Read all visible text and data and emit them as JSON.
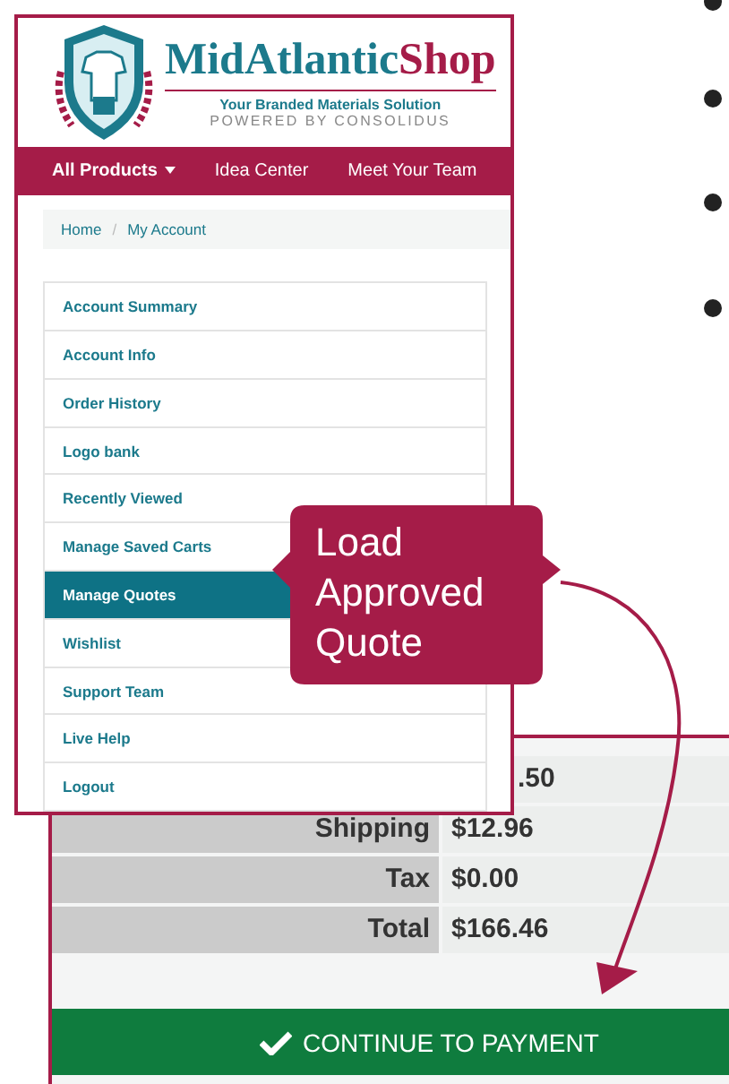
{
  "shop_window": {
    "logo": {
      "name_parts": [
        "MidAtlantic",
        "Shop"
      ],
      "tagline": "Your Branded Materials Solution",
      "powered_by": "POWERED BY CONSOLIDUS"
    },
    "nav": [
      {
        "label": "All Products",
        "has_menu": true
      },
      {
        "label": "Idea Center",
        "has_menu": false
      },
      {
        "label": "Meet Your Team",
        "has_menu": false
      }
    ],
    "breadcrumb": [
      "Home",
      "/",
      "My Account"
    ],
    "account_menu": [
      {
        "label": "Account Summary",
        "selected": false
      },
      {
        "label": "Account Info",
        "selected": false
      },
      {
        "label": "Order History",
        "selected": false
      },
      {
        "label": "Logo bank",
        "selected": false
      },
      {
        "label": "Recently Viewed",
        "selected": false
      },
      {
        "label": "Manage Saved Carts",
        "selected": false
      },
      {
        "label": "Manage Quotes",
        "selected": true
      },
      {
        "label": "Wishlist",
        "selected": false
      },
      {
        "label": "Support Team",
        "selected": false
      },
      {
        "label": "Live Help",
        "selected": false
      },
      {
        "label": "Logout",
        "selected": false
      }
    ]
  },
  "checkout_window": {
    "totals": [
      {
        "value": ".50"
      },
      {
        "label": "Shipping",
        "value": "$12.96"
      },
      {
        "label": "Tax",
        "value": "$0.00"
      },
      {
        "label": "Total",
        "value": "$166.46"
      }
    ],
    "continue_button": "CONTINUE TO PAYMENT"
  },
  "callout": "Load Approved Quote"
}
